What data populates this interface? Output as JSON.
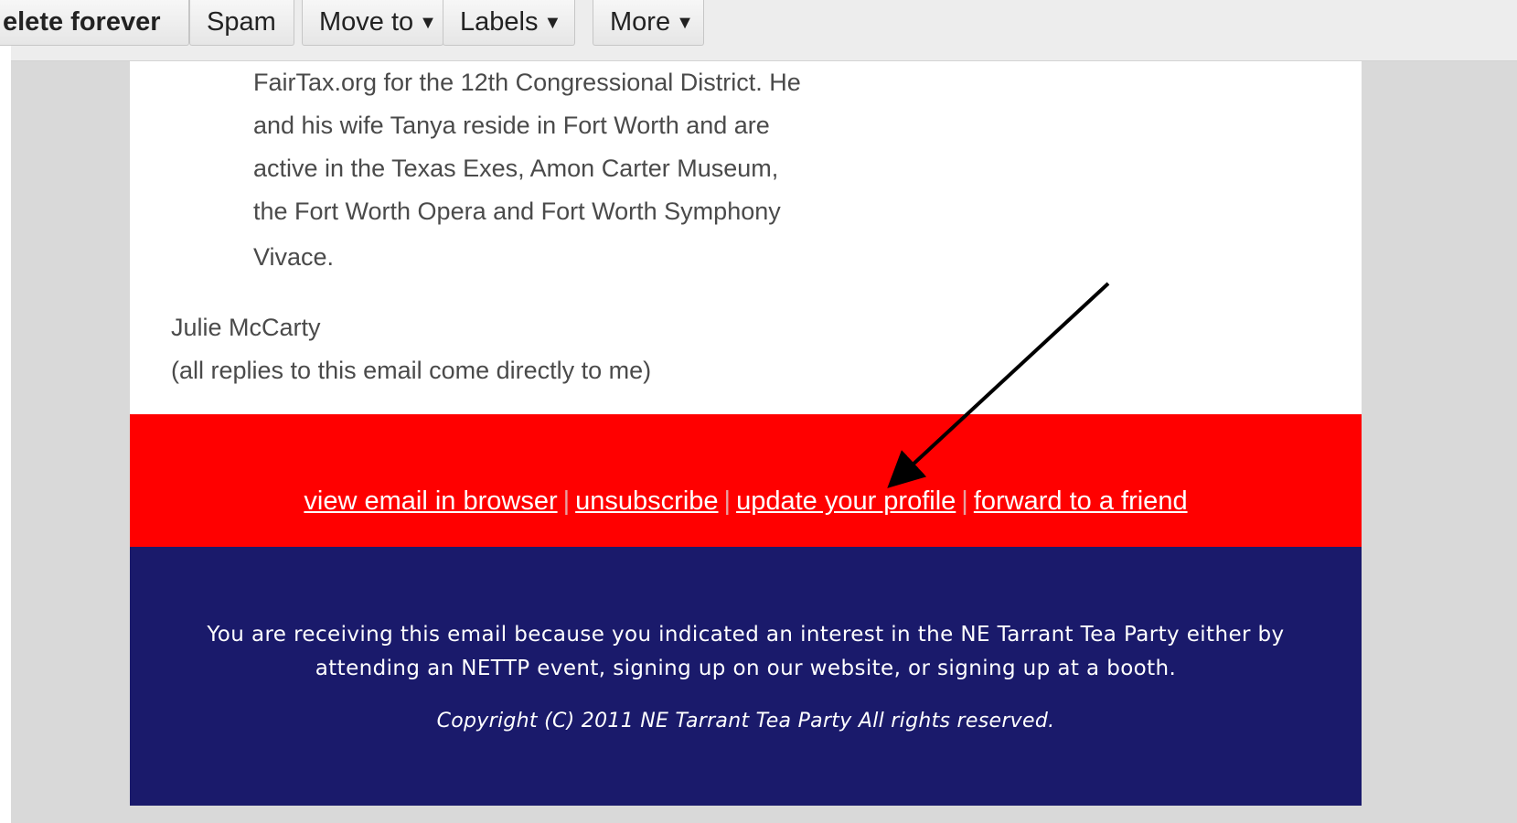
{
  "toolbar": {
    "delete_forever": "elete forever",
    "spam": "Spam",
    "move_to": "Move to",
    "labels": "Labels",
    "more": "More",
    "caret": "▼"
  },
  "email": {
    "bio_lines": [
      "FairTax.org for the 12th Congressional District.  He",
      "and his wife Tanya reside in Fort Worth and are",
      "active in the Texas Exes, Amon Carter Museum,",
      "the Fort Worth Opera and Fort Worth Symphony",
      "Vivace."
    ],
    "signature_name": "Julie McCarty",
    "signature_note": "(all replies to this email come directly to me)"
  },
  "footer": {
    "links": {
      "view_in_browser": "view email in browser",
      "unsubscribe": "unsubscribe",
      "update_profile": "update your profile",
      "forward": "forward to a friend",
      "separator": "|"
    },
    "notice": "You are receiving this email because you indicated an interest in the NE Tarrant Tea Party either by attending an NETTP event, signing up on our website, or signing up at a booth.",
    "copyright": "Copyright (C) 2011 NE Tarrant Tea Party All rights reserved."
  },
  "colors": {
    "red_band": "#ff0000",
    "blue_band": "#1a1a6b",
    "pane_bg": "#d9d9d9"
  }
}
